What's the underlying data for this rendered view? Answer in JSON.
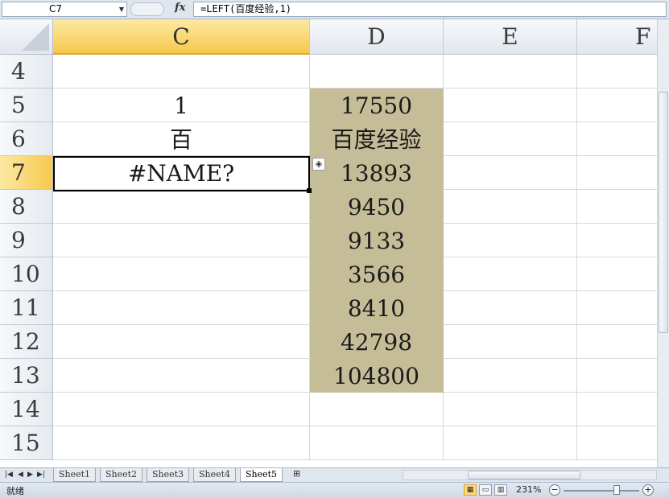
{
  "formula_bar": {
    "name_box": "C7",
    "fx_label": "fx",
    "formula": "=LEFT(百度经验,1)"
  },
  "columns": [
    "C",
    "D",
    "E",
    "F"
  ],
  "rows": [
    "4",
    "5",
    "6",
    "7",
    "8",
    "9",
    "10",
    "11",
    "12",
    "13",
    "14",
    "15"
  ],
  "cells": {
    "C5": "1",
    "C6": "百",
    "C7": "#NAME?",
    "D5": "17550",
    "D6": "百度经验",
    "D7": "13893",
    "D8": "9450",
    "D9": "9133",
    "D10": "3566",
    "D11": "8410",
    "D12": "42798",
    "D13": "104800"
  },
  "sheet_tabs": [
    "Sheet1",
    "Sheet2",
    "Sheet3",
    "Sheet4",
    "Sheet5"
  ],
  "active_sheet": "Sheet5",
  "status_bar": {
    "status": "就绪",
    "zoom": "231%"
  },
  "colors": {
    "shaded_fill": "#c5bd97",
    "active_header": "#f7c84e"
  },
  "icons": {
    "error_flag": "warning-diamond-icon"
  }
}
